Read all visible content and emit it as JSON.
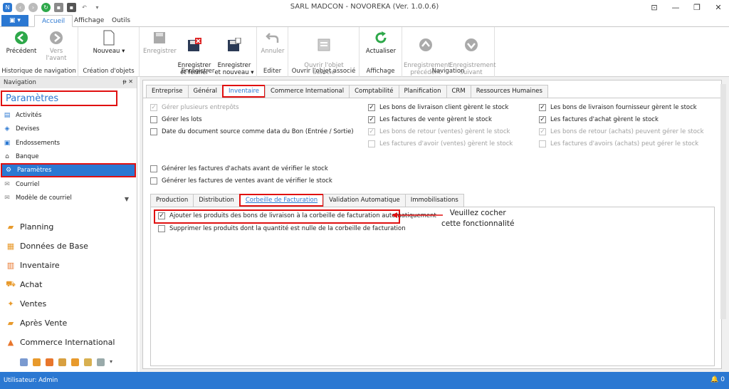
{
  "window": {
    "title": "SARL MADCON - NOVOREKA (Ver. 1.0.0.6)"
  },
  "menu": {
    "tabs": [
      "Accueil",
      "Affichage",
      "Outils"
    ],
    "active": "Accueil"
  },
  "ribbon": {
    "groups": [
      {
        "label": "Historique de navigation",
        "buttons": [
          "Précédent",
          "Vers l'avant"
        ]
      },
      {
        "label": "Création d'objets",
        "buttons": [
          "Nouveau"
        ]
      },
      {
        "label": "Enregistrer",
        "buttons": [
          "Enregistrer",
          "Enregistrer\net fermer",
          "Enregistrer\net nouveau"
        ]
      },
      {
        "label": "Editer",
        "buttons": [
          "Annuler"
        ]
      },
      {
        "label": "Ouvrir l'objet associé",
        "buttons": [
          "Ouvrir l'objet\nassocié"
        ]
      },
      {
        "label": "Affichage",
        "buttons": [
          "Actualiser"
        ]
      },
      {
        "label": "Navigation",
        "buttons": [
          "Enregistrement\nprécédent",
          "Enregistrement\nsuivant"
        ]
      }
    ]
  },
  "nav": {
    "header": "Navigation",
    "section_title": "Paramètres",
    "items": [
      "Activités",
      "Devises",
      "Endossements",
      "Banque",
      "Paramètres",
      "Courriel",
      "Modèle de courriel"
    ],
    "modules": [
      "Planning",
      "Données de Base",
      "Inventaire",
      "Achat",
      "Ventes",
      "Après Vente",
      "Commerce International"
    ]
  },
  "tabs": {
    "main": [
      "Entreprise",
      "Général",
      "Inventaire",
      "Commerce International",
      "Comptabilité",
      "Planification",
      "CRM",
      "Ressources Humaines"
    ],
    "active_main": "Inventaire",
    "sub": [
      "Production",
      "Distribution",
      "Corbeille de Facturation",
      "Validation Automatique",
      "Immobilisations"
    ],
    "active_sub": "Corbeille de Facturation"
  },
  "options": {
    "col1": [
      {
        "label": "Gérer plusieurs entrepôts",
        "checked": true,
        "disabled": true
      },
      {
        "label": "Gérer les lots",
        "checked": false,
        "disabled": false
      },
      {
        "label": "Date du document source comme data du Bon (Entrée / Sortie)",
        "checked": false,
        "disabled": false
      }
    ],
    "col2": [
      {
        "label": "Les bons de livraison client gèrent le stock",
        "checked": true,
        "disabled": false
      },
      {
        "label": "Les factures de vente gèrent le stock",
        "checked": true,
        "disabled": false
      },
      {
        "label": "Les bons de retour (ventes) gèrent le stock",
        "checked": true,
        "disabled": true
      },
      {
        "label": "Les factures d'avoir (ventes) gèrent le stock",
        "checked": false,
        "disabled": true
      }
    ],
    "col3": [
      {
        "label": "Les bons de livraison fournisseur gèrent le stock",
        "checked": true,
        "disabled": false
      },
      {
        "label": "Les factures d'achat gèrent le stock",
        "checked": true,
        "disabled": false
      },
      {
        "label": "Les bons de retour (achats) peuvent gérer le stock",
        "checked": true,
        "disabled": true
      },
      {
        "label": "Les factures d'avoirs (achats) peut gérer le stock",
        "checked": false,
        "disabled": true
      }
    ],
    "mid": [
      {
        "label": "Générer les factures d'achats avant de vérifier le stock",
        "checked": false
      },
      {
        "label": "Générer les factures de ventes avant de vérifier le stock",
        "checked": false
      }
    ],
    "billing": [
      {
        "label": "Ajouter les produits des bons de livraison à la corbeille de facturation automatiquement",
        "checked": true
      },
      {
        "label": "Supprimer les produits dont la quantité est nulle de la corbeille de facturation",
        "checked": false
      }
    ]
  },
  "annotation": {
    "line1": "Veuillez cocher",
    "line2": "cette fonctionnalité"
  },
  "status": {
    "user": "Utilisateur: Admin",
    "notifications": "0"
  },
  "colors": {
    "accent": "#2b78d2",
    "highlight": "#e01010"
  }
}
